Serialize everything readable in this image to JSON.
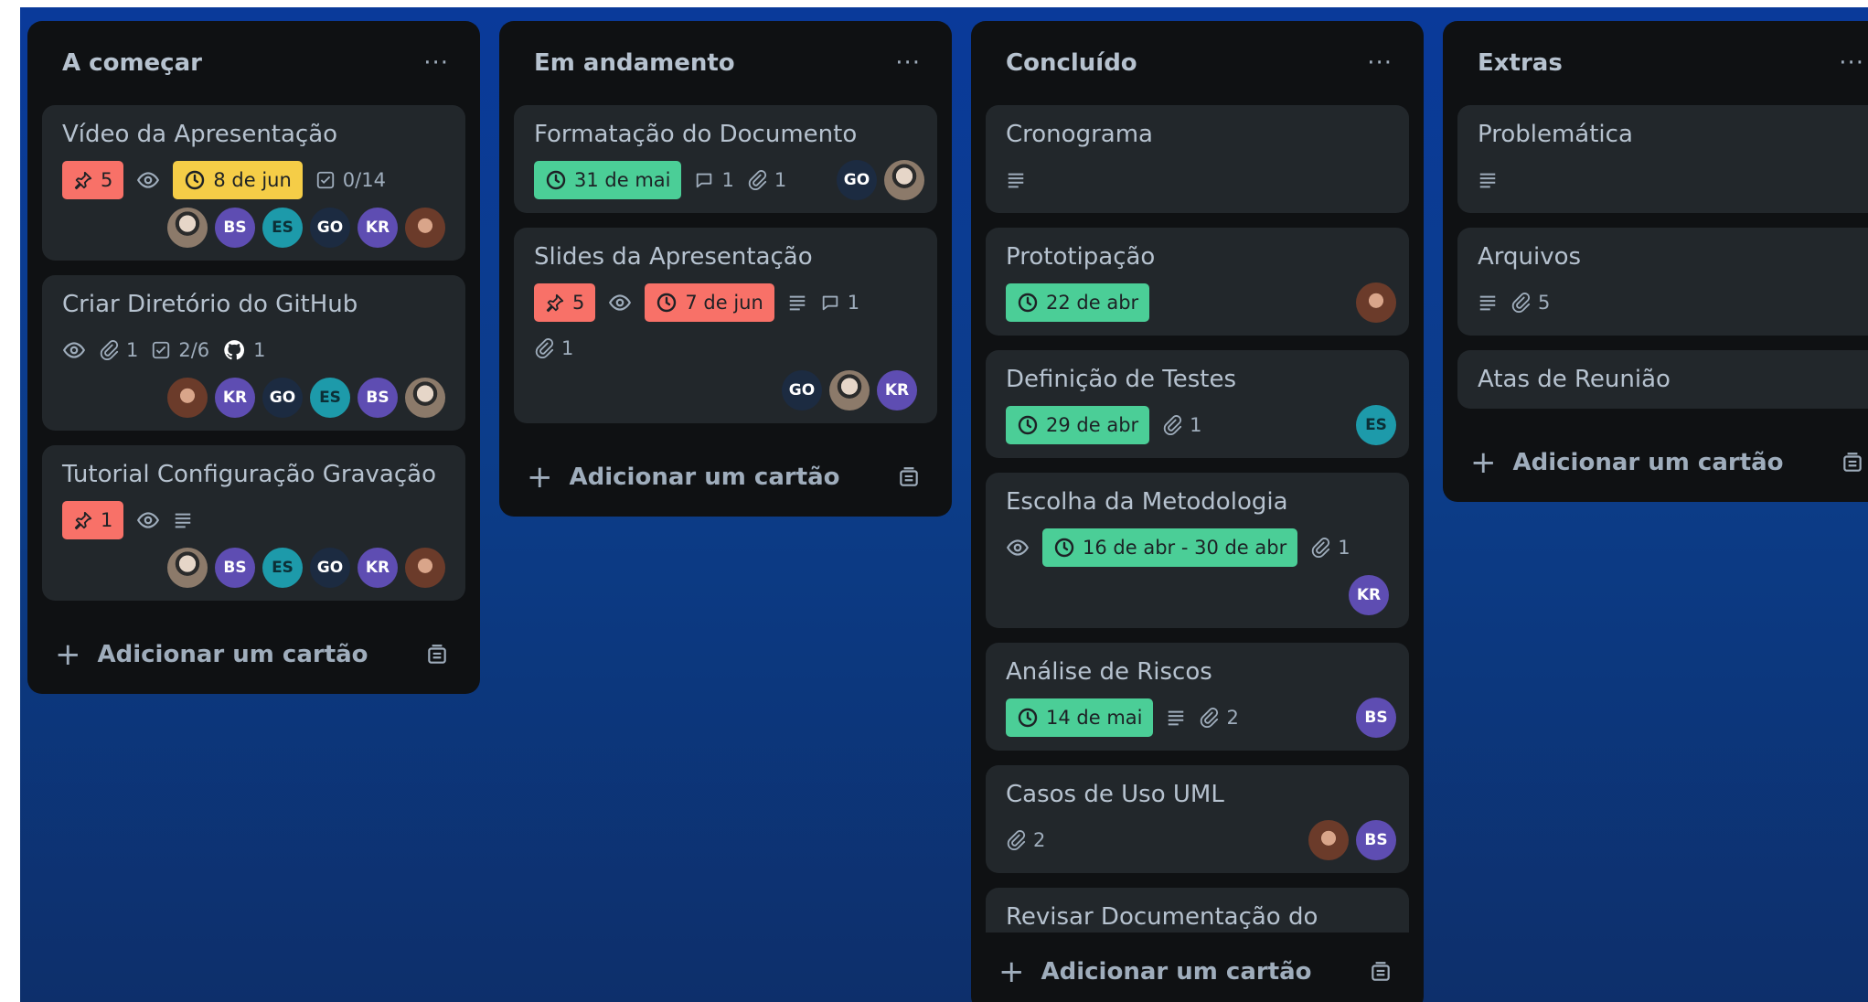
{
  "colors": {
    "board_top": "#0a3a9a",
    "board_bottom": "#0d2f6b",
    "list_bg": "#0f1113",
    "card_bg": "#22272b",
    "text": "#b6c2cf",
    "red_badge": "#f87168",
    "yellow_badge": "#f5cd47",
    "green_badge": "#4bce97",
    "purple_avatar": "#5e4db2",
    "teal_avatar": "#1d9aaa",
    "navy_avatar": "#1c2b41"
  },
  "lists": [
    {
      "title": "A começar",
      "menu": "···",
      "add_label": "Adicionar um cartão",
      "cards": [
        {
          "title": "Vídeo da Apresentação",
          "votes": "5",
          "due": "8 de jun",
          "checklist": "0/14"
        },
        {
          "title": "Criar Diretório do GitHub",
          "attachments": "1",
          "checklist": "2/6",
          "github": "1"
        },
        {
          "title": "Tutorial Configuração Gravação",
          "votes": "1"
        }
      ]
    },
    {
      "title": "Em andamento",
      "menu": "···",
      "add_label": "Adicionar um cartão",
      "cards": [
        {
          "title": "Formatação do Documento",
          "due": "31 de mai",
          "comments": "1",
          "attachments": "1"
        },
        {
          "title": "Slides da Apresentação",
          "votes": "5",
          "due": "7 de jun",
          "comments": "1",
          "attachments": "1"
        }
      ]
    },
    {
      "title": "Concluído",
      "menu": "···",
      "add_label": "Adicionar um cartão",
      "cards": [
        {
          "title": "Cronograma"
        },
        {
          "title": "Prototipação",
          "due": "22 de abr"
        },
        {
          "title": "Definição de Testes",
          "due": "29 de abr",
          "attachments": "1"
        },
        {
          "title": "Escolha da Metodologia",
          "due": "16 de abr - 30 de abr",
          "attachments": "1"
        },
        {
          "title": "Análise de Riscos",
          "due": "14 de mai",
          "attachments": "2"
        },
        {
          "title": "Casos de Uso UML",
          "attachments": "2"
        },
        {
          "title": "Revisar Documentação do Sistema"
        }
      ]
    },
    {
      "title": "Extras",
      "menu": "···",
      "add_label": "Adicionar um cartão",
      "cards": [
        {
          "title": "Problemática"
        },
        {
          "title": "Arquivos",
          "attachments": "5"
        },
        {
          "title": "Atas de Reunião"
        }
      ]
    }
  ],
  "members": {
    "BS": "BS",
    "ES": "ES",
    "GO": "GO",
    "KR": "KR"
  },
  "icons": {
    "vote": "pin-icon",
    "watch": "eye-icon",
    "due": "clock-icon",
    "checklist": "checkbox-icon",
    "attachment": "paperclip-icon",
    "comment": "comment-icon",
    "description": "description-icon",
    "github": "github-icon",
    "add": "plus-icon",
    "template": "template-icon",
    "menu": "ellipsis-icon"
  }
}
